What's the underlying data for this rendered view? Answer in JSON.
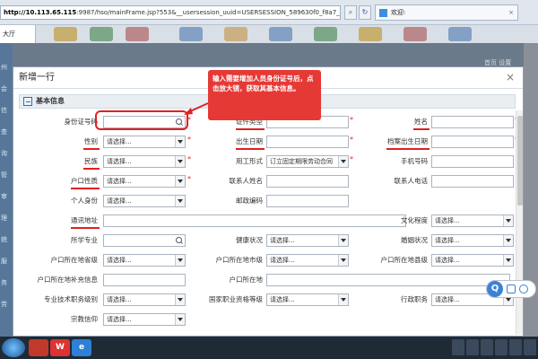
{
  "browser": {
    "url_host": "http://10.113.65.115",
    "url_rest": ":9987/hso/mainFrame.jsp?553&__usersession_uuid=USERSESSION_589630f0_f8a7_4b6d_8e46_4304267c",
    "tab_title": "欢迎:",
    "app_tab": "大厅"
  },
  "dialog": {
    "title": "新增一行",
    "section": "基本信息"
  },
  "form": {
    "labels": {
      "id_no": "身份证号码",
      "id_type": "证件类型",
      "name": "姓名",
      "gender": "性别",
      "birth": "出生日期",
      "file_birth": "档案出生日期",
      "ethnic": "民族",
      "employ_form": "用工形式",
      "phone": "手机号码",
      "hukou_type": "户口性质",
      "contact_name": "联系人姓名",
      "contact_phone": "联系人电话",
      "personal_id": "个人身份",
      "postcode": "邮政编码",
      "address": "通讯地址",
      "education": "文化程度",
      "major": "所学专业",
      "health": "健康状况",
      "marital": "婚姻状况",
      "hukou_province": "户口所在地省级",
      "hukou_city": "户口所在地市级",
      "hukou_county": "户口所在地县级",
      "hukou_detail": "户口所在地补充信息",
      "hukou_place": "户口所在地",
      "tech_level": "专业技术职务级别",
      "qual_level": "国家职业资格等级",
      "admin_post": "行政职务",
      "religion": "宗教信仰"
    },
    "select_placeholder": "请选择...",
    "employ_form_value": "订立固定期限劳动合同"
  },
  "callout": {
    "text": "输入需要增加人员身份证号后，点击放大镜，获取其基本信息。"
  },
  "background": {
    "side_labels": [
      "州",
      "会",
      "信",
      "查",
      "询",
      "管",
      "审",
      "理",
      "统",
      "服",
      "务",
      "劳"
    ],
    "top_right": "首页 设置"
  },
  "float_widget": {
    "badge": "Q"
  },
  "taskbar": {
    "wps_label": "W"
  }
}
